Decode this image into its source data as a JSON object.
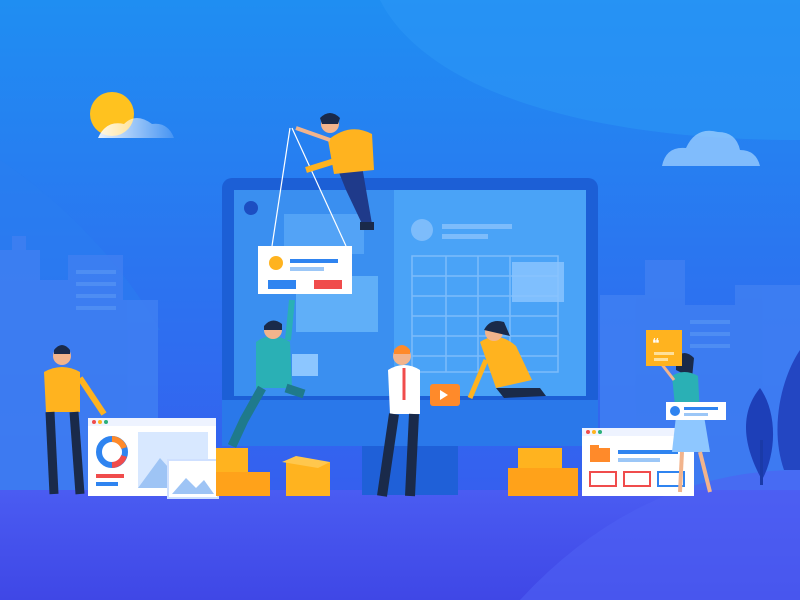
{
  "scene": {
    "palette": {
      "bg_top": "#1f86f0",
      "bg_bottom": "#3b5bf0",
      "accent_orange": "#ffb31f",
      "monitor_frame": "#1f6fe0",
      "screen_left": "#3a8ff0",
      "screen_right": "#4aa0f5",
      "card_red": "#f04c4c",
      "card_blue": "#2f84f0",
      "white": "#ffffff"
    },
    "icons": [
      "sun-icon",
      "cloud-icon",
      "monitor-icon",
      "donut-chart-icon",
      "image-icon",
      "folder-icon",
      "quote-icon",
      "play-icon",
      "box-icon",
      "tree-icon"
    ]
  }
}
